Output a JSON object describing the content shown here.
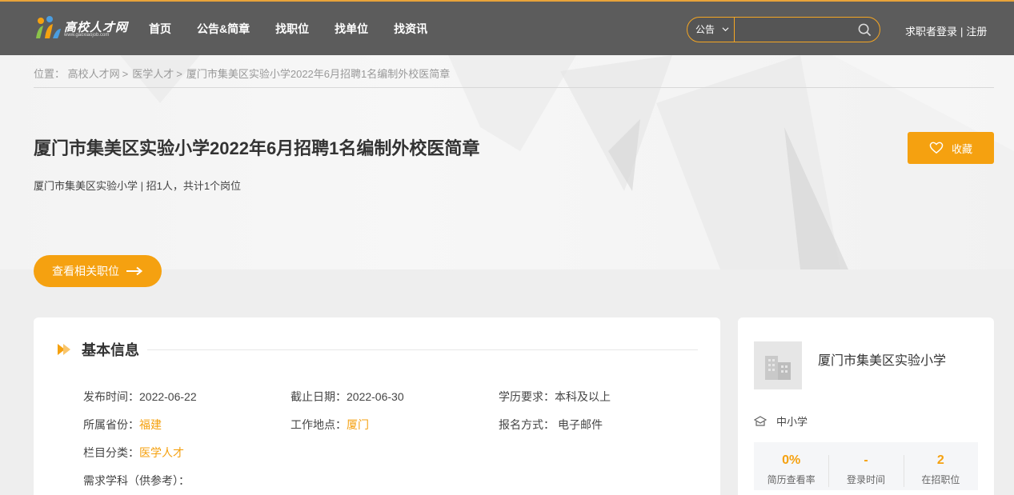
{
  "header": {
    "logo_text": "高校人才网",
    "logo_url": "www.gaoxiaojob.com",
    "nav": [
      {
        "label": "首页"
      },
      {
        "label": "公告&简章"
      },
      {
        "label": "找职位"
      },
      {
        "label": "找单位"
      },
      {
        "label": "找资讯"
      }
    ],
    "search": {
      "category": "公告",
      "value": "",
      "placeholder": ""
    },
    "auth": {
      "login": "求职者登录",
      "sep": "|",
      "register": "注册"
    }
  },
  "breadcrumb": {
    "prefix": "位置：",
    "items": [
      "高校人才网",
      "医学人才",
      "厦门市集美区实验小学2022年6月招聘1名编制外校医简章"
    ],
    "sep": ">"
  },
  "announcement": {
    "title": "厦门市集美区实验小学2022年6月招聘1名编制外校医简章",
    "subtitle": "厦门市集美区实验小学 | 招1人，共计1个岗位",
    "favorite_label": "收藏",
    "related_label": "查看相关职位"
  },
  "basic_info": {
    "heading": "基本信息",
    "publish_label": "发布时间：",
    "publish_value": "2022-06-22",
    "deadline_label": "截止日期：",
    "deadline_value": "2022-06-30",
    "education_label": "学历要求：",
    "education_value": "本科及以上",
    "province_label": "所属省份：",
    "province_value": "福建",
    "location_label": "工作地点：",
    "location_value": "厦门",
    "apply_label": "报名方式：",
    "apply_value": "电子邮件",
    "column_label": "栏目分类：",
    "column_value": "医学人才",
    "subject_label": "需求学科（供参考）：",
    "subject_value": ""
  },
  "company": {
    "name": "厦门市集美区实验小学",
    "type": "中小学",
    "stats": [
      {
        "value": "0%",
        "label": "简历查看率"
      },
      {
        "value": "-",
        "label": "登录时间"
      },
      {
        "value": "2",
        "label": "在招职位"
      }
    ]
  },
  "colors": {
    "accent": "#f5a110",
    "header_bg": "#5c5c5c",
    "page_bg": "#eeeeee"
  }
}
